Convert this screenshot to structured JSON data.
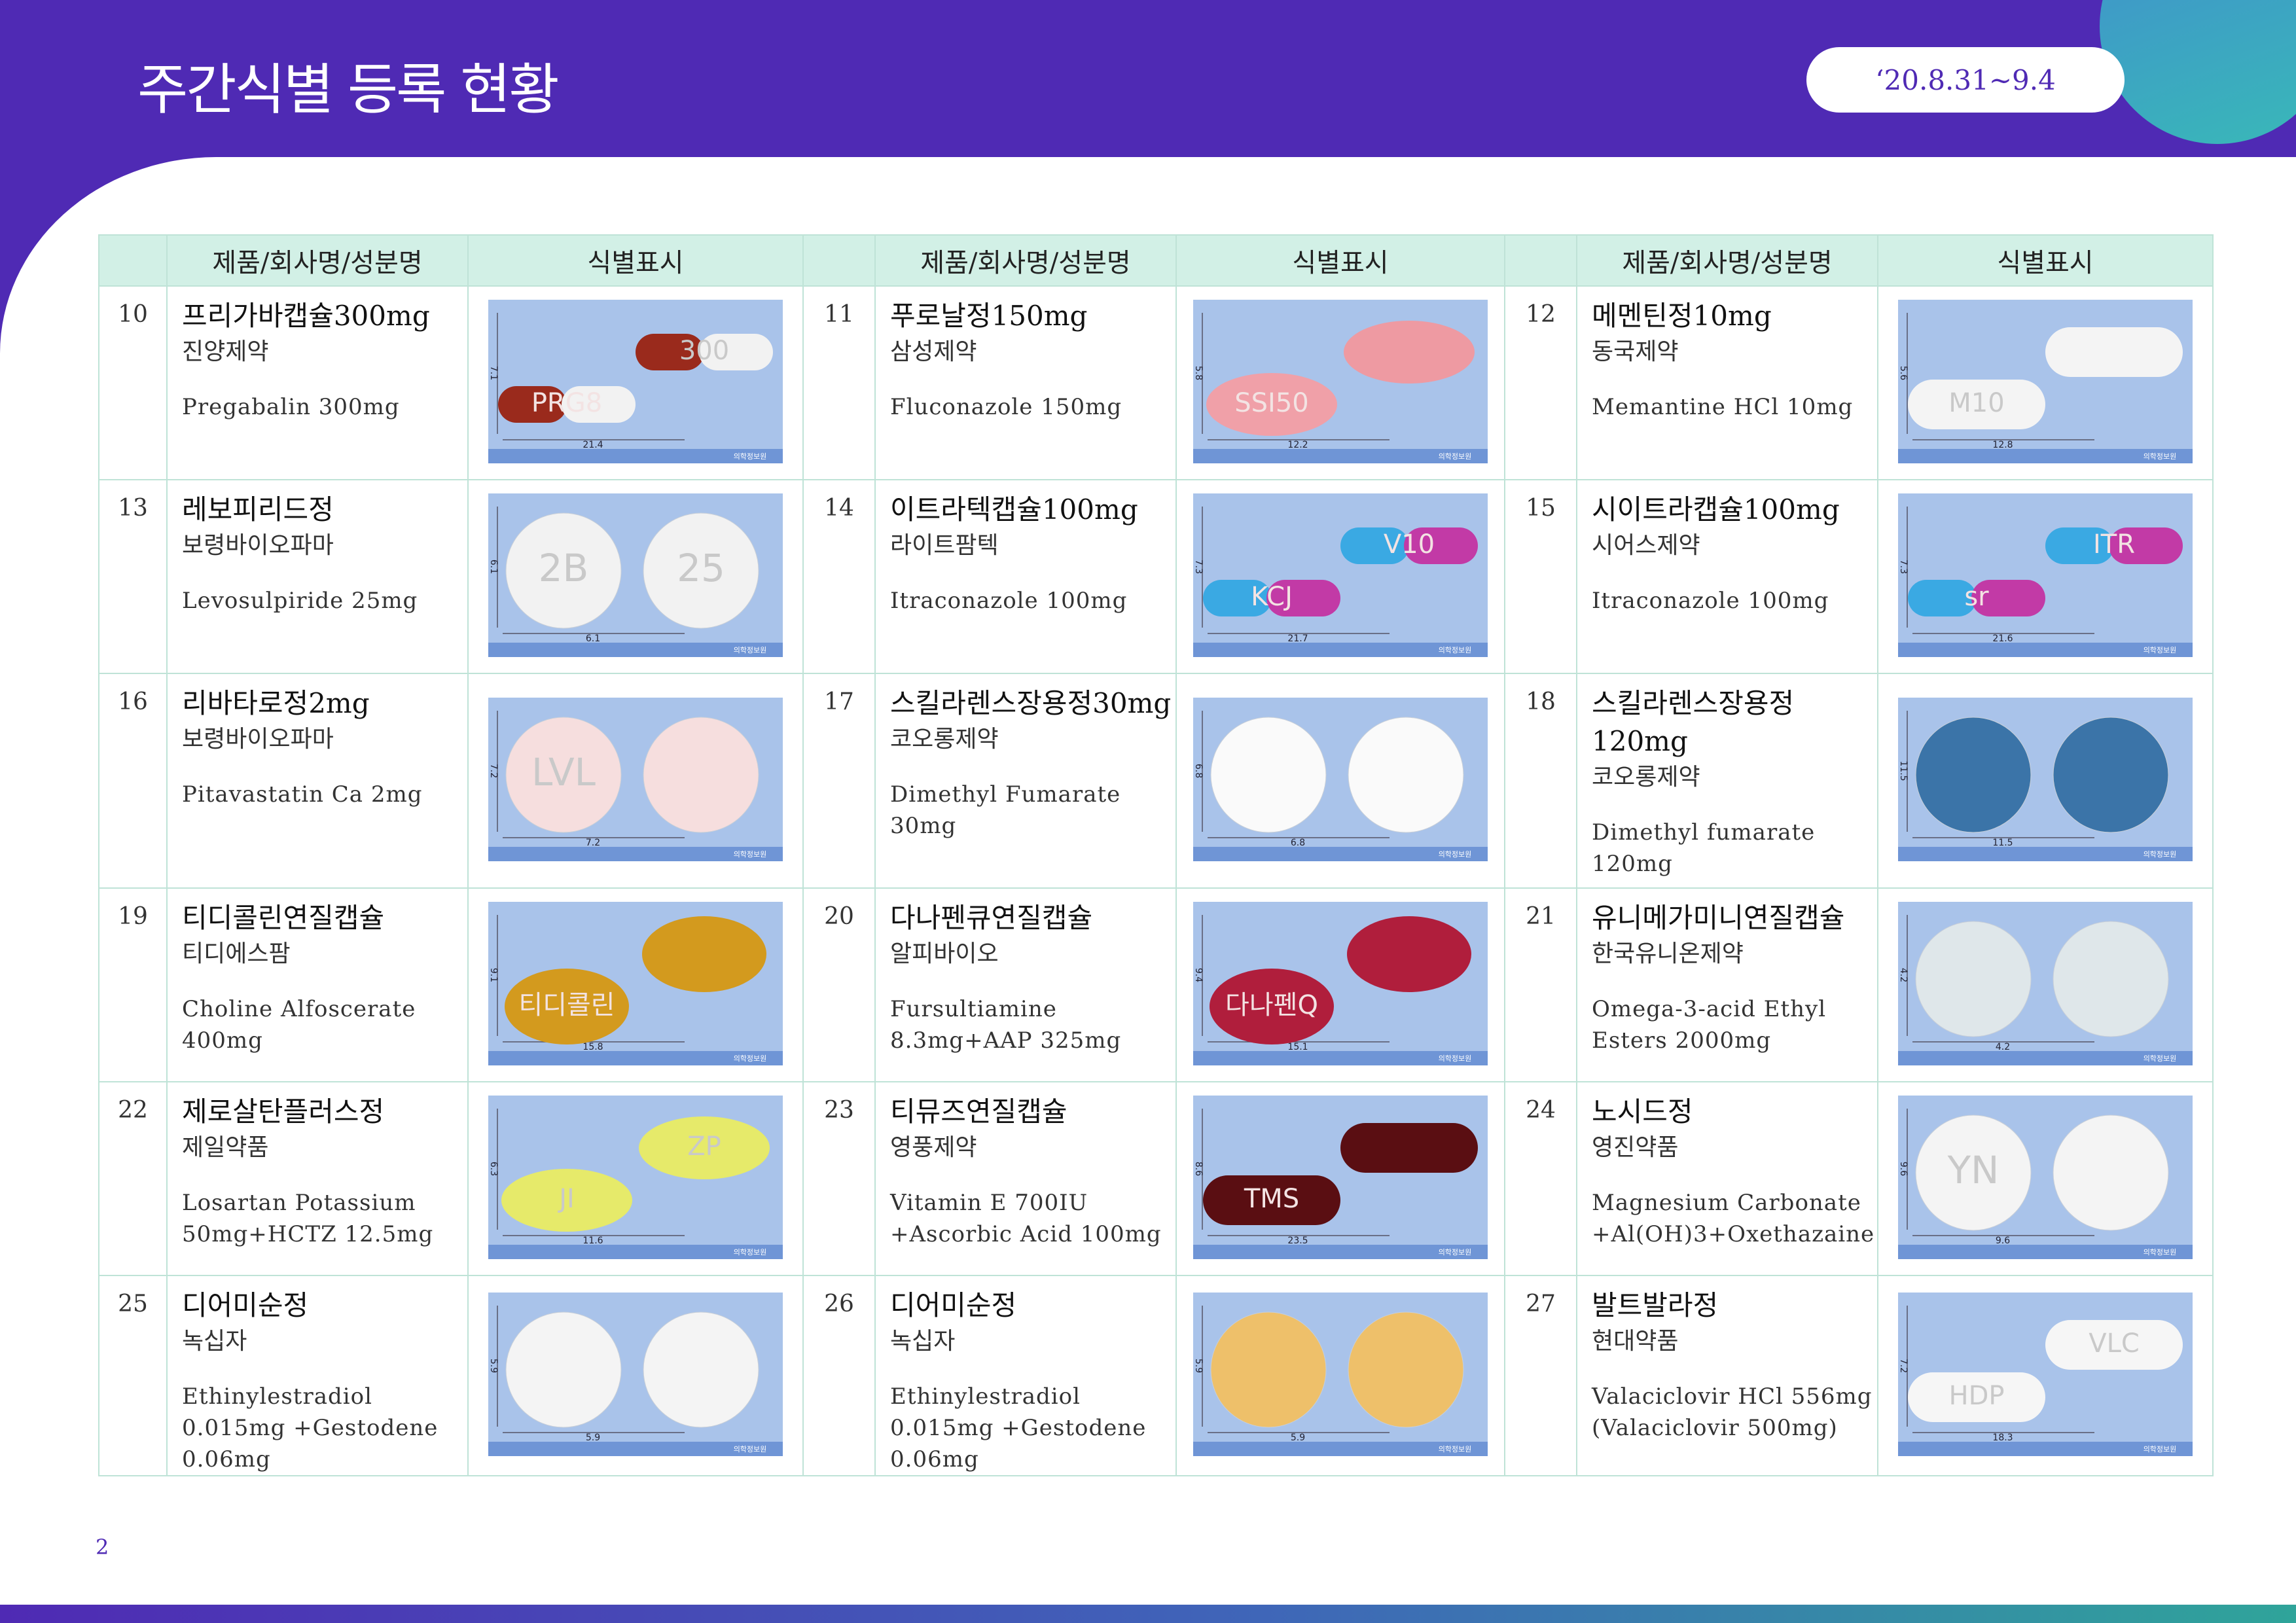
{
  "header": {
    "title": "주간식별 등록 현황",
    "date_range": "‘20.8.31~9.4"
  },
  "table": {
    "columns": [
      "제품/회사명/성분명",
      "식별표시"
    ],
    "photo_footer": "의학정보원",
    "rows": [
      [
        {
          "no": "10",
          "name": "프리가바캡슐300mg",
          "company": "진양제약",
          "ingredient": "Pregabalin 300mg",
          "dims": {
            "h": "7.1",
            "w": "21.4"
          },
          "marks": [
            "PRG8",
            "300"
          ],
          "shape": "capsule",
          "colors": [
            "#9a2a1c",
            "#f2f2f2"
          ]
        },
        {
          "no": "11",
          "name": "푸로날정150mg",
          "company": "삼성제약",
          "ingredient": "Fluconazole 150mg",
          "dims": {
            "h": "5.8",
            "w": "12.2"
          },
          "marks": [
            "SSI50",
            ""
          ],
          "shape": "oval",
          "colors": [
            "#f0a0a8",
            "#ee9aa2"
          ]
        },
        {
          "no": "12",
          "name": "메멘틴정10mg",
          "company": "동국제약",
          "ingredient": "Memantine HCl 10mg",
          "dims": {
            "h": "5.6",
            "w": "12.8"
          },
          "marks": [
            "M10",
            ""
          ],
          "shape": "oblong",
          "colors": [
            "#f4f4f4",
            "#f4f4f4"
          ]
        }
      ],
      [
        {
          "no": "13",
          "name": "레보피리드정",
          "company": "보령바이오파마",
          "ingredient": "Levosulpiride 25mg",
          "dims": {
            "h": "6.1",
            "w": "6.1"
          },
          "marks": [
            "2B",
            "25"
          ],
          "shape": "round",
          "colors": [
            "#f2f2f2",
            "#f2f2f2"
          ]
        },
        {
          "no": "14",
          "name": "이트라텍캡슐100mg",
          "company": "라이트팜텍",
          "ingredient": "Itraconazole 100mg",
          "dims": {
            "h": "7.3",
            "w": "21.7"
          },
          "marks": [
            "KCJ",
            "V10"
          ],
          "shape": "capsule",
          "colors": [
            "#3aa9e3",
            "#c23aa6"
          ]
        },
        {
          "no": "15",
          "name": "시이트라캡슐100mg",
          "company": "시어스제약",
          "ingredient": "Itraconazole 100mg",
          "dims": {
            "h": "7.3",
            "w": "21.6"
          },
          "marks": [
            "sr",
            "ITR"
          ],
          "shape": "capsule",
          "colors": [
            "#3aa9e3",
            "#c23aa6"
          ]
        }
      ],
      [
        {
          "no": "16",
          "name": "리바타로정2mg",
          "company": "보령바이오파마",
          "ingredient": "Pitavastatin Ca 2mg",
          "dims": {
            "h": "7.2",
            "w": "7.2"
          },
          "marks": [
            "LVL",
            ""
          ],
          "shape": "round",
          "colors": [
            "#f6dede",
            "#f6dede"
          ]
        },
        {
          "no": "17",
          "name": "스킬라렌스장용정30mg",
          "company": "코오롱제약",
          "ingredient": "Dimethyl Fumarate 30mg",
          "dims": {
            "h": "6.8",
            "w": "6.8"
          },
          "marks": [
            "",
            ""
          ],
          "shape": "round",
          "colors": [
            "#fafafa",
            "#fafafa"
          ]
        },
        {
          "no": "18",
          "name": "스킬라렌스장용정 120mg",
          "company": "코오롱제약",
          "ingredient": "Dimethyl fumarate 120mg",
          "dims": {
            "h": "11.5",
            "w": "11.5"
          },
          "marks": [
            "",
            ""
          ],
          "shape": "round",
          "colors": [
            "#3b74a8",
            "#3b74a8"
          ]
        }
      ],
      [
        {
          "no": "19",
          "name": "티디콜린연질캡슐",
          "company": "티디에스팜",
          "ingredient": "Choline Alfoscerate 400mg",
          "dims": {
            "h": "9.1",
            "w": "15.8"
          },
          "marks": [
            "티디콜린",
            ""
          ],
          "shape": "softgel",
          "colors": [
            "#d39a1e",
            "#d39a1e"
          ]
        },
        {
          "no": "20",
          "name": "다나펜큐연질캡슐",
          "company": "알피바이오",
          "ingredient": "Fursultiamine 8.3mg+AAP 325mg",
          "dims": {
            "h": "9.4",
            "w": "15.1"
          },
          "marks": [
            "다나펜Q",
            ""
          ],
          "shape": "softgel",
          "colors": [
            "#b01e3c",
            "#b01e3c"
          ]
        },
        {
          "no": "21",
          "name": "유니메가미니연질캡슐",
          "company": "한국유니온제약",
          "ingredient": "Omega-3-acid Ethyl Esters 2000mg",
          "dims": {
            "h": "4.2",
            "w": "4.2"
          },
          "marks": [
            "",
            ""
          ],
          "shape": "round",
          "colors": [
            "#dfe7ea",
            "#dfe7ea"
          ]
        }
      ],
      [
        {
          "no": "22",
          "name": "제로살탄플러스정",
          "company": "제일약품",
          "ingredient": "Losartan Potassium 50mg+HCTZ 12.5mg",
          "dims": {
            "h": "6.3",
            "w": "11.6"
          },
          "marks": [
            "JI",
            "ZP"
          ],
          "shape": "oval",
          "colors": [
            "#e6ea6a",
            "#e6ea6a"
          ]
        },
        {
          "no": "23",
          "name": "티뮤즈연질캡슐",
          "company": "영풍제약",
          "ingredient": "Vitamin E 700IU +Ascorbic Acid 100mg",
          "dims": {
            "h": "8.6",
            "w": "23.5"
          },
          "marks": [
            "TMS",
            ""
          ],
          "shape": "oblong",
          "colors": [
            "#5a0e12",
            "#5a0e12"
          ]
        },
        {
          "no": "24",
          "name": "노시드정",
          "company": "영진약품",
          "ingredient": "Magnesium Carbonate +Al(OH)3+Oxethazaine",
          "dims": {
            "h": "9.6",
            "w": "9.6"
          },
          "marks": [
            "YN",
            ""
          ],
          "shape": "round",
          "colors": [
            "#f4f4f4",
            "#f4f4f4"
          ]
        }
      ],
      [
        {
          "no": "25",
          "name": "디어미순정",
          "company": "녹십자",
          "ingredient": "Ethinylestradiol 0.015mg +Gestodene 0.06mg",
          "dims": {
            "h": "5.9",
            "w": "5.9"
          },
          "marks": [
            "",
            ""
          ],
          "shape": "round",
          "colors": [
            "#f4f4f4",
            "#f4f4f4"
          ]
        },
        {
          "no": "26",
          "name": "디어미순정",
          "company": "녹십자",
          "ingredient": "Ethinylestradiol 0.015mg +Gestodene 0.06mg",
          "dims": {
            "h": "5.9",
            "w": "5.9"
          },
          "marks": [
            "",
            ""
          ],
          "shape": "round",
          "colors": [
            "#eec06a",
            "#eec06a"
          ]
        },
        {
          "no": "27",
          "name": "발트발라정",
          "company": "현대약품",
          "ingredient": "Valaciclovir HCl 556mg (Valaciclovir 500mg)",
          "dims": {
            "h": "7.2",
            "w": "18.3"
          },
          "marks": [
            "HDP",
            "VLC"
          ],
          "shape": "oblong",
          "colors": [
            "#f6f6f6",
            "#f6f6f6"
          ]
        }
      ]
    ]
  },
  "page_number": "2"
}
